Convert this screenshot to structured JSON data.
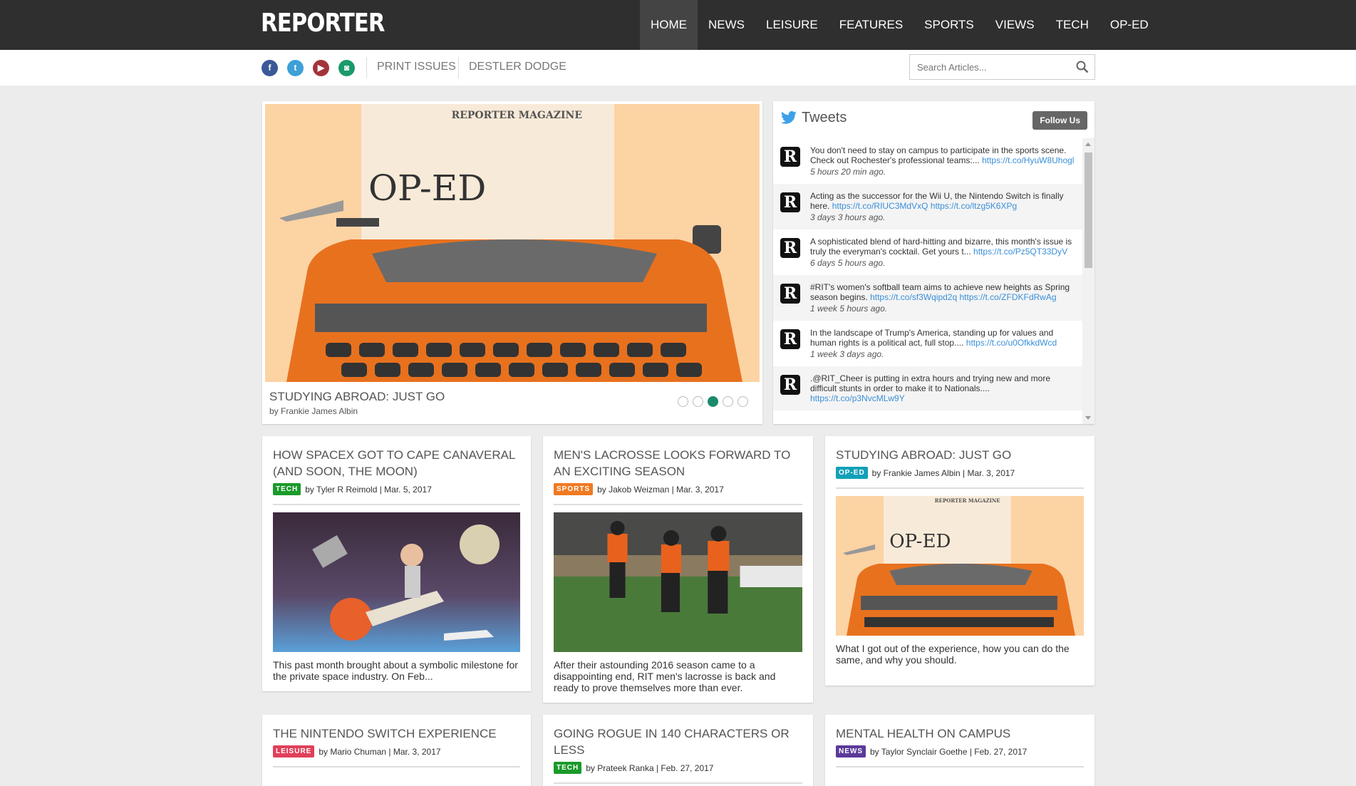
{
  "header": {
    "logo": "REPORTER",
    "nav": [
      "HOME",
      "NEWS",
      "LEISURE",
      "FEATURES",
      "SPORTS",
      "VIEWS",
      "TECH",
      "OP-ED"
    ],
    "active": "HOME"
  },
  "subbar": {
    "social": [
      {
        "name": "facebook",
        "glyph": "f",
        "color": "#3b5998"
      },
      {
        "name": "twitter",
        "glyph": "t",
        "color": "#3ea0d8"
      },
      {
        "name": "youtube",
        "glyph": "▶",
        "color": "#a3333a"
      },
      {
        "name": "instagram",
        "glyph": "◙",
        "color": "#1a9a6a"
      }
    ],
    "print_issues": "PRINT ISSUES",
    "destler": "DESTLER DODGE",
    "search_placeholder": "Search Articles..."
  },
  "slider": {
    "title": "STUDYING ABROAD: JUST GO",
    "byline": "by Frankie James Albin",
    "image_masthead": "REPORTER MAGAZINE",
    "image_text": "OP-ED",
    "slides": 5,
    "active_slide": 3
  },
  "tweets": {
    "title": "Tweets",
    "follow": "Follow Us",
    "items": [
      {
        "text": "You don't need to stay on campus to participate in the sports scene. Check out Rochester's professional teams:...",
        "links": [
          "https://t.co/HyuW8Uhogl"
        ],
        "time": "5 hours 20 min ago."
      },
      {
        "text": "Acting as the successor for the Wii U, the Nintendo Switch is finally here.",
        "links": [
          "https://t.co/RIUC3MdVxQ",
          "https://t.co/ltzg5K6XPg"
        ],
        "time": "3 days 3 hours ago."
      },
      {
        "text": "A sophisticated blend of hard-hitting and bizarre, this month's issue is truly the everyman's cocktail. Get yours t...",
        "links": [
          "https://t.co/Pz5QT33DyV"
        ],
        "time": "6 days 5 hours ago."
      },
      {
        "text": "#RIT's women's softball team aims to achieve new heights as Spring season begins.",
        "links": [
          "https://t.co/sf3Wqipd2q",
          "https://t.co/ZFDKFdRwAg"
        ],
        "time": "1 week 5 hours ago."
      },
      {
        "text": "In the landscape of Trump's America, standing up for values and human rights is a political act, full stop....",
        "links": [
          "https://t.co/u0OfkkdWcd"
        ],
        "time": "1 week 3 days ago."
      },
      {
        "text": ".@RIT_Cheer is putting in extra hours and trying new and more difficult stunts in order to make it to Nationals....",
        "links": [
          "https://t.co/p3NvcMLw9Y"
        ],
        "time": ""
      }
    ]
  },
  "articles": [
    {
      "title": "HOW SPACEX GOT TO CAPE CANAVERAL (AND SOON, THE MOON)",
      "tag": "TECH",
      "tag_color": "#1a9a2a",
      "byline": "by Tyler R Reimold | Mar. 5, 2017",
      "excerpt": "This past month brought about a symbolic milestone for the private space industry. On Feb...",
      "image": "space"
    },
    {
      "title": "MEN'S LACROSSE LOOKS FORWARD TO AN EXCITING SEASON",
      "tag": "SPORTS",
      "tag_color": "#f07a22",
      "byline": "by Jakob Weizman | Mar. 3, 2017",
      "excerpt": "After their astounding 2016 season came to a disappointing end, RIT men's lacrosse is back and ready to prove themselves more than ever.",
      "image": "lacrosse"
    },
    {
      "title": "STUDYING ABROAD: JUST GO",
      "tag": "OP-ED",
      "tag_color": "#12a0b8",
      "byline": "by Frankie James Albin | Mar. 3, 2017",
      "excerpt": "What I got out of the experience, how you can do the same, and why you should.",
      "image": "typewriter"
    },
    {
      "title": "THE NINTENDO SWITCH EXPERIENCE",
      "tag": "LEISURE",
      "tag_color": "#e0405a",
      "byline": "by Mario Chuman | Mar. 3, 2017"
    },
    {
      "title": "GOING ROGUE IN 140 CHARACTERS OR LESS",
      "tag": "TECH",
      "tag_color": "#1a9a2a",
      "byline": "by Prateek Ranka | Feb. 27, 2017"
    },
    {
      "title": "MENTAL HEALTH ON CAMPUS",
      "tag": "NEWS",
      "tag_color": "#5a3a9a",
      "byline": "by Taylor Synclair Goethe | Feb. 27, 2017"
    }
  ]
}
